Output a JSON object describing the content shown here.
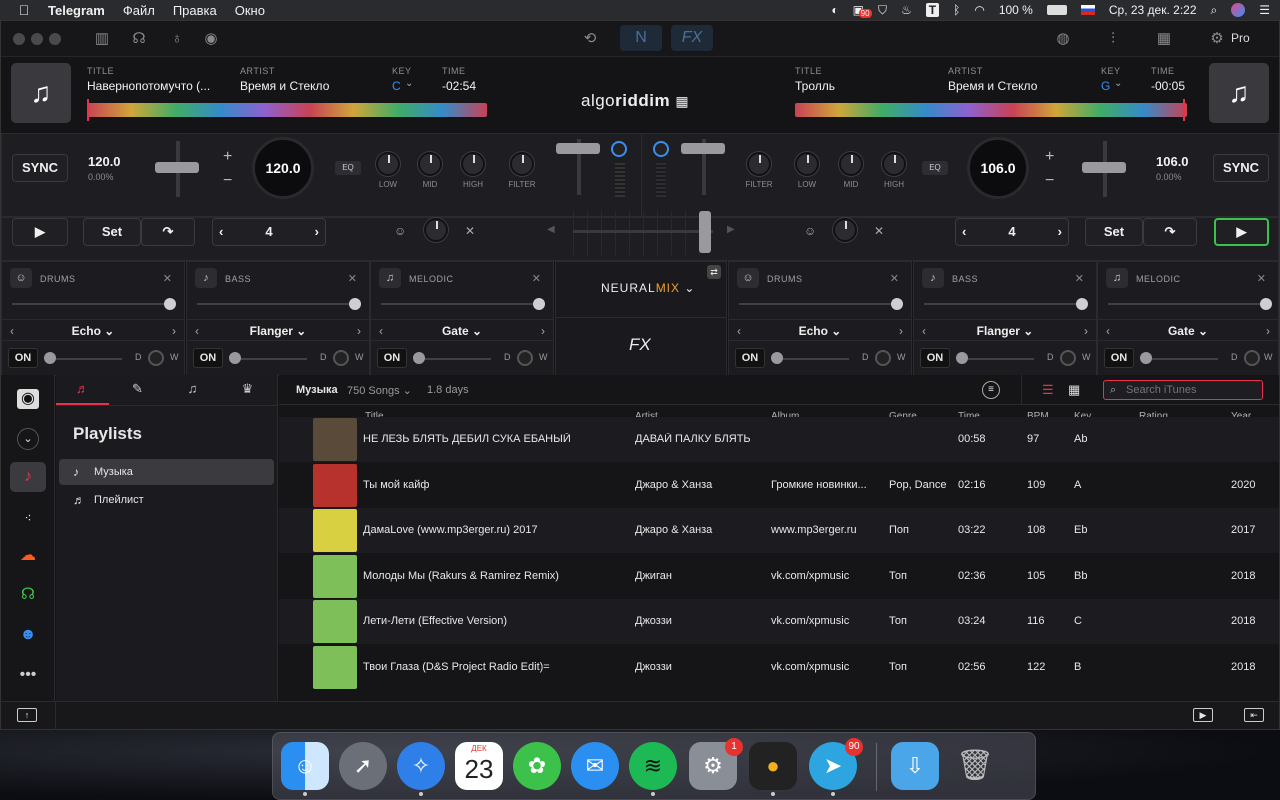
{
  "menubar": {
    "app": "Telegram",
    "items": [
      "Файл",
      "Правка",
      "Окно"
    ],
    "badge": "90",
    "battery": "100 %",
    "datetime": "Ср, 23 дек.  2:22"
  },
  "toolbar": {
    "neural_label": "N",
    "fx_label": "FX",
    "pro_label": "Pro"
  },
  "logo": {
    "part1": "algo",
    "part2": "riddim"
  },
  "deck_left": {
    "title_label": "TITLE",
    "title": "Навернопотомучто (...",
    "artist_label": "ARTIST",
    "artist": "Время и Стекло",
    "key_label": "KEY",
    "key": "C",
    "time_label": "TIME",
    "time": "-02:54",
    "bpm": "120.0",
    "pitch": "0.00%",
    "jog": "120.0",
    "sync": "SYNC",
    "set": "Set",
    "loop": "4"
  },
  "deck_right": {
    "title_label": "TITLE",
    "title": "Тролль",
    "artist_label": "ARTIST",
    "artist": "Время и Стекло",
    "key_label": "KEY",
    "key": "G",
    "time_label": "TIME",
    "time": "-00:05",
    "bpm": "106.0",
    "pitch": "0.00%",
    "jog": "106.0",
    "sync": "SYNC",
    "set": "Set",
    "loop": "4"
  },
  "eq": {
    "badge": "EQ",
    "labels": [
      "LOW",
      "MID",
      "HIGH",
      "FILTER"
    ]
  },
  "stems_left": [
    {
      "name": "DRUMS",
      "fx": "Echo",
      "on": "ON",
      "d": "D",
      "w": "W"
    },
    {
      "name": "BASS",
      "fx": "Flanger",
      "on": "ON",
      "d": "D",
      "w": "W"
    },
    {
      "name": "MELODIC",
      "fx": "Gate",
      "on": "ON",
      "d": "D",
      "w": "W"
    }
  ],
  "stems_right": [
    {
      "name": "DRUMS",
      "fx": "Echo",
      "on": "ON",
      "d": "D",
      "w": "W"
    },
    {
      "name": "BASS",
      "fx": "Flanger",
      "on": "ON",
      "d": "D",
      "w": "W"
    },
    {
      "name": "MELODIC",
      "fx": "Gate",
      "on": "ON",
      "d": "D",
      "w": "W"
    }
  ],
  "neuralmix": {
    "part1": "NEURAL",
    "part2": "MIX",
    "fx": "FX"
  },
  "sidebar": {
    "title": "Playlists",
    "items": [
      "Музыка",
      "Плейлист"
    ]
  },
  "library": {
    "source": "Музыка",
    "count": "750 Songs",
    "duration": "1.8 days",
    "search_placeholder": "Search iTunes",
    "columns": [
      "Title",
      "Artist",
      "Album",
      "Genre",
      "Time",
      "BPM",
      "Key",
      "Rating",
      "Year"
    ],
    "rows": [
      {
        "title": "НЕ ЛЕЗЬ БЛЯТЬ ДЕБИЛ СУКА ЕБАНЫЙ",
        "artist": "ДАВАЙ ПАЛКУ БЛЯТЬ",
        "album": "",
        "genre": "",
        "time": "00:58",
        "bpm": "97",
        "key": "Ab",
        "year": ""
      },
      {
        "title": "Ты мой кайф",
        "artist": "Джаро & Ханза",
        "album": "Громкие новинки...",
        "genre": "Pop, Dance",
        "time": "02:16",
        "bpm": "109",
        "key": "A",
        "year": "2020"
      },
      {
        "title": "ДамаLove (www.mp3erger.ru) 2017",
        "artist": "Джаро & Ханза",
        "album": "www.mp3erger.ru",
        "genre": "Поп",
        "time": "03:22",
        "bpm": "108",
        "key": "Eb",
        "year": "2017"
      },
      {
        "title": "Молоды Мы (Rakurs & Ramirez Remix)",
        "artist": "Джиган",
        "album": "vk.com/xpmusic",
        "genre": "Топ",
        "time": "02:36",
        "bpm": "105",
        "key": "Bb",
        "year": "2018"
      },
      {
        "title": "Лети-Лети (Effective Version)",
        "artist": "Джоззи",
        "album": "vk.com/xpmusic",
        "genre": "Топ",
        "time": "03:24",
        "bpm": "116",
        "key": "C",
        "year": "2018"
      },
      {
        "title": "Твои Глаза (D&S Project Radio Edit)=",
        "artist": "Джоззи",
        "album": "vk.com/xpmusic",
        "genre": "Топ",
        "time": "02:56",
        "bpm": "122",
        "key": "B",
        "year": "2018"
      }
    ]
  },
  "dock": {
    "calendar_month": "ДЕК",
    "calendar_day": "23",
    "sysprefs_badge": "1",
    "telegram_badge": "90"
  },
  "colors": {
    "accent_red": "#e8324a",
    "accent_blue": "#3a8ef0",
    "play_green": "#3cc24a"
  }
}
